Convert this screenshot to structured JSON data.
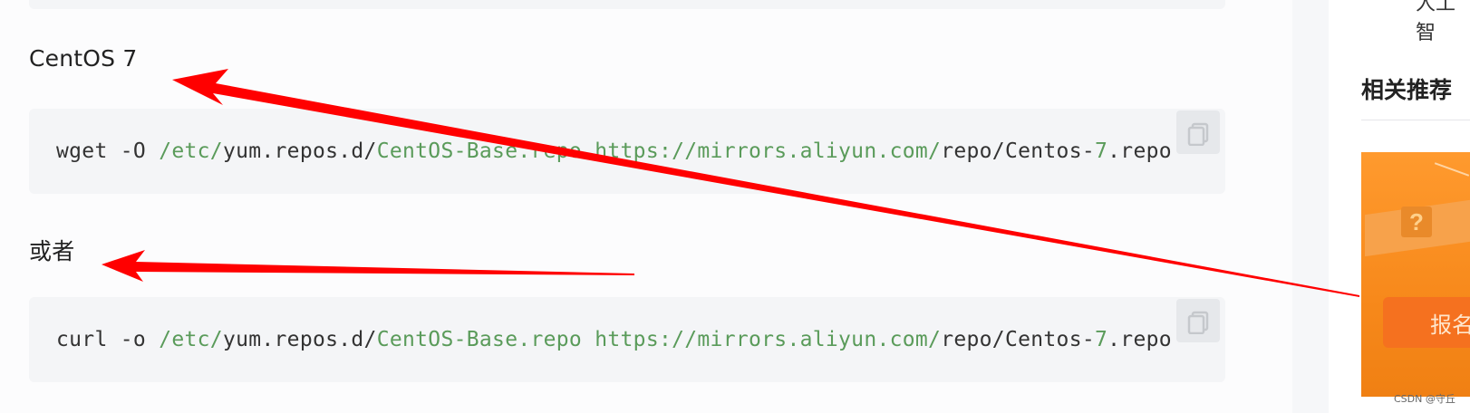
{
  "article": {
    "heading_centos7": "CentOS 7",
    "heading_or": "或者",
    "code_wget": {
      "cmd": "wget -O ",
      "path1": "/etc/",
      "path2": "yum.repos.d/",
      "path3": "CentOS-Base.repo",
      "space": " ",
      "url1": "https://mirrors.aliyun.com/",
      "url2": "repo/Centos-",
      "url3": "7",
      "url4": ".repo"
    },
    "code_curl": {
      "cmd": "curl -o ",
      "path1": "/etc/",
      "path2": "yum.repos.d/",
      "path3": "CentOS-Base.repo",
      "space": " ",
      "url1": "https://mirrors.aliyun.com/",
      "url2": "repo/Centos-",
      "url3": "7",
      "url4": ".repo"
    },
    "copy_icon": "copy-icon"
  },
  "sidebar": {
    "top_text": "人工智",
    "title": "相关推荐",
    "ad_button": "报名",
    "ad_badge": "?"
  },
  "watermark": "CSDN @守丘",
  "colors": {
    "code_highlight": "#5a9b5a",
    "arrow": "#ff0000",
    "ad_orange": "#f7891b"
  }
}
